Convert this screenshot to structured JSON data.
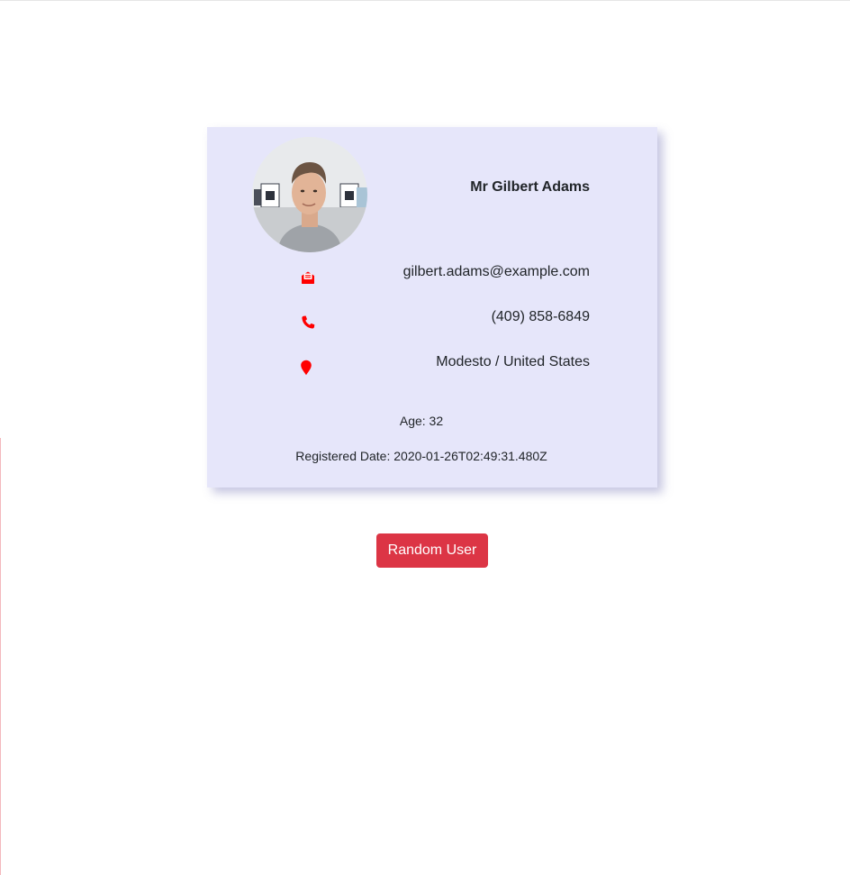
{
  "user": {
    "full_name": "Mr Gilbert Adams",
    "email": "gilbert.adams@example.com",
    "phone": "(409) 858-6849",
    "location": "Modesto / United States",
    "age_text": "Age: 32",
    "registered_text": "Registered Date: 2020-01-26T02:49:31.480Z"
  },
  "icons": {
    "email": "envelope-open-icon",
    "phone": "phone-icon",
    "location": "map-marker-icon"
  },
  "actions": {
    "random_user_label": "Random User"
  },
  "colors": {
    "card_background": "#e6e6fa",
    "icon_color": "#ff0000",
    "button_background": "#dc3545",
    "button_text": "#ffffff"
  }
}
